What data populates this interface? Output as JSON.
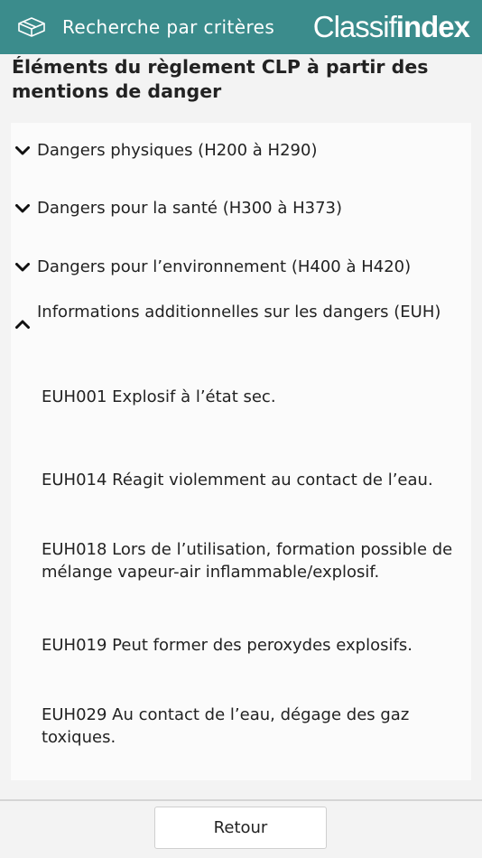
{
  "header": {
    "menu_icon": "box-icon",
    "title": "Recherche par critères",
    "brand_part1": "Classif",
    "brand_part2": "index",
    "background_color": "#3b8c8c"
  },
  "page": {
    "heading": "Éléments du règlement CLP à partir des mentions de danger"
  },
  "sections": [
    {
      "label": "Dangers physiques (H200 à H290)",
      "expanded": false,
      "icon": "chevron-down-icon"
    },
    {
      "label": "Dangers pour la santé (H300 à H373)",
      "expanded": false,
      "icon": "chevron-down-icon"
    },
    {
      "label": "Dangers pour l’environnement (H400 à H420)",
      "expanded": false,
      "icon": "chevron-down-icon"
    },
    {
      "label": "Informations additionnelles sur les dangers (EUH)",
      "expanded": true,
      "icon": "chevron-up-icon"
    }
  ],
  "euh_items": [
    "EUH001 Explosif à l’état sec.",
    "EUH014 Réagit violemment au contact de l’eau.",
    "EUH018 Lors de l’utilisation, formation possible de mélange vapeur-air inflammable/explosif.",
    "EUH019 Peut former des peroxydes explosifs.",
    "EUH029 Au contact de l’eau, dégage des gaz toxiques."
  ],
  "footer": {
    "back_label": "Retour"
  }
}
